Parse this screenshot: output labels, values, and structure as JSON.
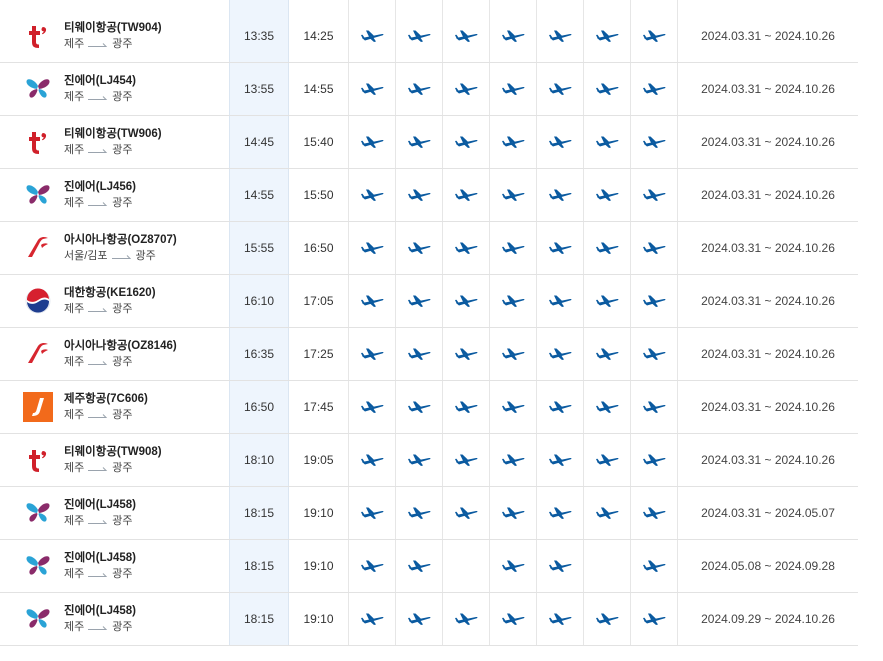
{
  "colors": {
    "plane": "#0a5aa0",
    "tway": "#d0202a",
    "jinair_a": "#8a2b6a",
    "jinair_b": "#2aa3d6",
    "asiana": "#d7262f",
    "korean_red": "#d6202f",
    "korean_blue": "#1e3d8f",
    "jeju": "#f26a1b"
  },
  "flights": [
    {
      "name": "티웨이항공(TW904)",
      "logo": "tway-logo",
      "from": "제주",
      "to": "광주",
      "dep": "13:35",
      "arr": "14:25",
      "days": [
        1,
        1,
        1,
        1,
        1,
        1,
        1
      ],
      "period": "2024.03.31 ~ 2024.10.26"
    },
    {
      "name": "진에어(LJ454)",
      "logo": "jinair-logo",
      "from": "제주",
      "to": "광주",
      "dep": "13:55",
      "arr": "14:55",
      "days": [
        1,
        1,
        1,
        1,
        1,
        1,
        1
      ],
      "period": "2024.03.31 ~ 2024.10.26"
    },
    {
      "name": "티웨이항공(TW906)",
      "logo": "tway-logo",
      "from": "제주",
      "to": "광주",
      "dep": "14:45",
      "arr": "15:40",
      "days": [
        1,
        1,
        1,
        1,
        1,
        1,
        1
      ],
      "period": "2024.03.31 ~ 2024.10.26"
    },
    {
      "name": "진에어(LJ456)",
      "logo": "jinair-logo",
      "from": "제주",
      "to": "광주",
      "dep": "14:55",
      "arr": "15:50",
      "days": [
        1,
        1,
        1,
        1,
        1,
        1,
        1
      ],
      "period": "2024.03.31 ~ 2024.10.26"
    },
    {
      "name": "아시아나항공(OZ8707)",
      "logo": "asiana-logo",
      "from": "서울/김포",
      "to": "광주",
      "dep": "15:55",
      "arr": "16:50",
      "days": [
        1,
        1,
        1,
        1,
        1,
        1,
        1
      ],
      "period": "2024.03.31 ~ 2024.10.26"
    },
    {
      "name": "대한항공(KE1620)",
      "logo": "korean-air-logo",
      "from": "제주",
      "to": "광주",
      "dep": "16:10",
      "arr": "17:05",
      "days": [
        1,
        1,
        1,
        1,
        1,
        1,
        1
      ],
      "period": "2024.03.31 ~ 2024.10.26"
    },
    {
      "name": "아시아나항공(OZ8146)",
      "logo": "asiana-logo",
      "from": "제주",
      "to": "광주",
      "dep": "16:35",
      "arr": "17:25",
      "days": [
        1,
        1,
        1,
        1,
        1,
        1,
        1
      ],
      "period": "2024.03.31 ~ 2024.10.26"
    },
    {
      "name": "제주항공(7C606)",
      "logo": "jeju-air-logo",
      "from": "제주",
      "to": "광주",
      "dep": "16:50",
      "arr": "17:45",
      "days": [
        1,
        1,
        1,
        1,
        1,
        1,
        1
      ],
      "period": "2024.03.31 ~ 2024.10.26"
    },
    {
      "name": "티웨이항공(TW908)",
      "logo": "tway-logo",
      "from": "제주",
      "to": "광주",
      "dep": "18:10",
      "arr": "19:05",
      "days": [
        1,
        1,
        1,
        1,
        1,
        1,
        1
      ],
      "period": "2024.03.31 ~ 2024.10.26"
    },
    {
      "name": "진에어(LJ458)",
      "logo": "jinair-logo",
      "from": "제주",
      "to": "광주",
      "dep": "18:15",
      "arr": "19:10",
      "days": [
        1,
        1,
        1,
        1,
        1,
        1,
        1
      ],
      "period": "2024.03.31 ~ 2024.05.07"
    },
    {
      "name": "진에어(LJ458)",
      "logo": "jinair-logo",
      "from": "제주",
      "to": "광주",
      "dep": "18:15",
      "arr": "19:10",
      "days": [
        1,
        1,
        0,
        1,
        1,
        0,
        1
      ],
      "period": "2024.05.08 ~ 2024.09.28"
    },
    {
      "name": "진에어(LJ458)",
      "logo": "jinair-logo",
      "from": "제주",
      "to": "광주",
      "dep": "18:15",
      "arr": "19:10",
      "days": [
        1,
        1,
        1,
        1,
        1,
        1,
        1
      ],
      "period": "2024.09.29 ~ 2024.10.26"
    }
  ]
}
